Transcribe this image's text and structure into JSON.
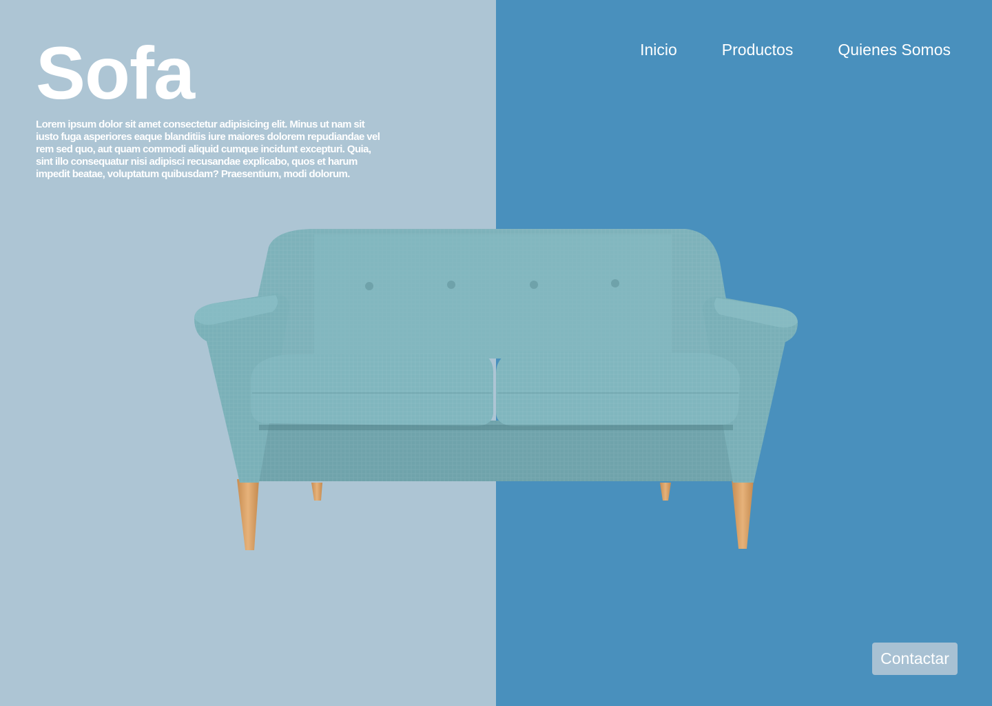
{
  "hero": {
    "title": "Sofa",
    "description": "Lorem ipsum dolor sit amet consectetur adipisicing elit. Minus ut nam sit iusto fuga asperiores eaque blanditiis iure maiores dolorem repudiandae vel rem sed quo, aut quam commodi aliquid cumque incidunt excepturi. Quia, sint illo consequatur nisi adipisci recusandae explicabo, quos et harum impedit beatae, voluptatum quibusdam? Praesentium, modi dolorum."
  },
  "nav": {
    "items": [
      {
        "label": "Inicio"
      },
      {
        "label": "Productos"
      },
      {
        "label": "Quienes Somos"
      }
    ]
  },
  "cta": {
    "contact_label": "Contactar"
  },
  "colors": {
    "left_panel": "#adc5d4",
    "right_panel": "#4990bd",
    "sofa_fabric": "#7fb5bd",
    "sofa_legs": "#d9a56a"
  }
}
